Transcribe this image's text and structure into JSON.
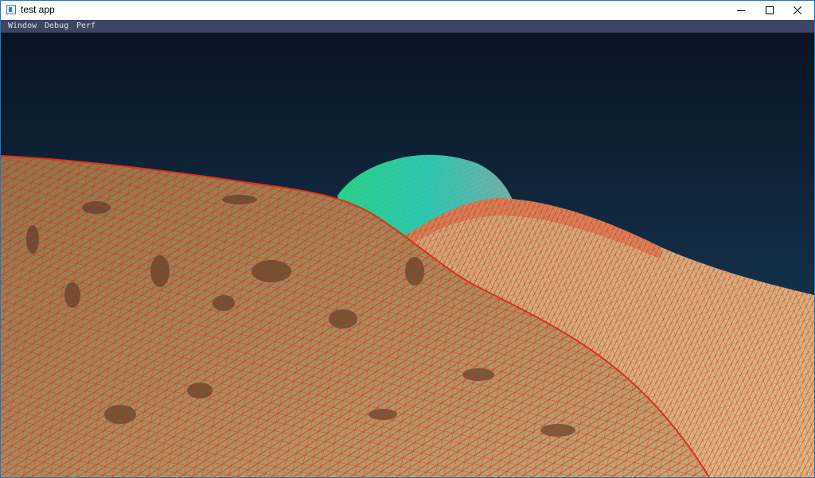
{
  "window": {
    "title": "test app",
    "icon": "app-icon",
    "controls": [
      "minimize-icon",
      "maximize-icon",
      "close-icon"
    ]
  },
  "menubar": {
    "items": [
      {
        "label": "Window"
      },
      {
        "label": "Debug"
      },
      {
        "label": "Perf"
      }
    ]
  },
  "scene": {
    "sky_top": "#0a1422",
    "sky_bottom": "#1a4466",
    "terrain_color": "#b49566",
    "wireframe_color": "#e02010",
    "selected_wireframe_color": "#1fc8b0"
  }
}
